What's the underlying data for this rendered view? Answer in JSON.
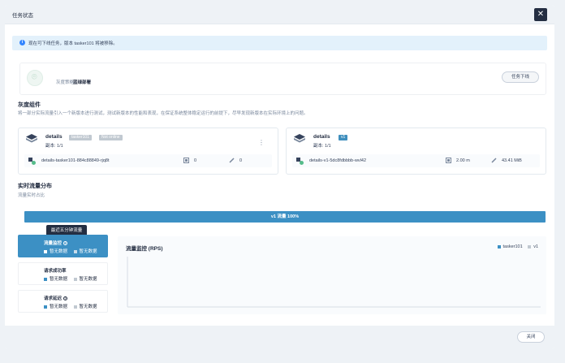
{
  "modal": {
    "title": "任务状态",
    "close_icon": "close-icon"
  },
  "alert": {
    "text": "现在可下线任务，版本 tasker101 将被移除。",
    "icon": "info-icon"
  },
  "strategy": {
    "label": "灰度策略",
    "value": "蓝绿部署",
    "offline_label": "任务下线"
  },
  "components": {
    "title": "灰度组件",
    "desc": "将一部分实际流量引入一个新版本进行测试，测试新版本的性能和表现，在保证系统整体稳定运行的前提下，尽早发现新版本在实际环境上的问题。",
    "cards": [
      {
        "name": "details",
        "tags": [
          "tasker101",
          "Not online"
        ],
        "replicas": "副本: 1/1",
        "pod": "details-tasker101-884c88849-rjq8t",
        "cpu": "0",
        "memory": "0"
      },
      {
        "name": "details",
        "tags": [
          "v1"
        ],
        "replicas": "副本: 1/1",
        "pod": "details-v1-5dc8fdbbbb-wvl42",
        "cpu": "2.00 m",
        "memory": "43.41 MiB"
      }
    ]
  },
  "traffic": {
    "title": "实时流量分布",
    "desc": "流量实时占比",
    "bar_label": "v1 流量 100%",
    "v1_percent": 100
  },
  "monitor": {
    "tooltip": "最近五分钟流量",
    "tabs": [
      {
        "title": "流量监控",
        "legend_a": "暂无数据",
        "legend_b": "暂无数据",
        "has_info": true
      },
      {
        "title": "请求成功率",
        "legend_a": "暂无数据",
        "legend_b": "暂无数据",
        "has_info": false
      },
      {
        "title": "请求延迟",
        "legend_a": "暂无数据",
        "legend_b": "暂无数据",
        "has_info": true
      }
    ],
    "chart": {
      "title": "流量监控 (RPS)",
      "legend": [
        "tasker101",
        "v1"
      ]
    }
  },
  "footer": {
    "close_label": "关闭"
  },
  "colors": {
    "accent": "#3c90c4",
    "dark": "#242e42",
    "legend_a": "#3c90c4",
    "legend_b": "#c1c9d1"
  },
  "chart_data": {
    "type": "line",
    "title": "流量监控 (RPS)",
    "series": [
      {
        "name": "tasker101",
        "values": []
      },
      {
        "name": "v1",
        "values": []
      }
    ],
    "legend": "top-right"
  }
}
